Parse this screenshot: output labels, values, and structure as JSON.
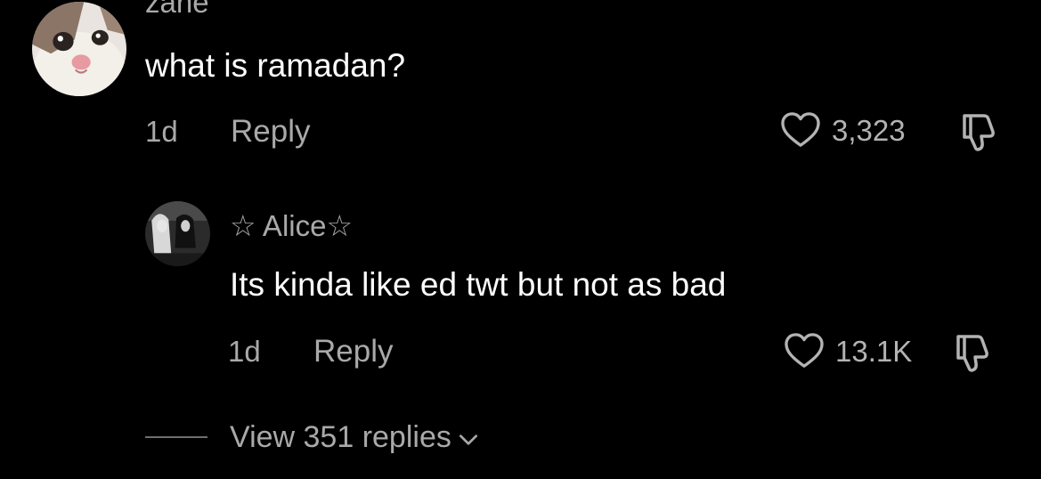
{
  "comment": {
    "author": "zane",
    "text": "what is ramadan?",
    "age": "1d",
    "reply_label": "Reply",
    "likes": "3,323"
  },
  "reply": {
    "author": "☆ Alice☆",
    "text": "Its kinda like ed twt but not as bad",
    "age": "1d",
    "reply_label": "Reply",
    "likes": "13.1K"
  },
  "view_replies": "View 351 replies",
  "icons": {
    "like": "heart-outline-icon",
    "dislike": "thumbs-down-icon",
    "expand": "chevron-down-icon"
  },
  "colors": {
    "background": "#000000",
    "primary_text": "#ffffff",
    "secondary_text": "#a9a9a9"
  }
}
